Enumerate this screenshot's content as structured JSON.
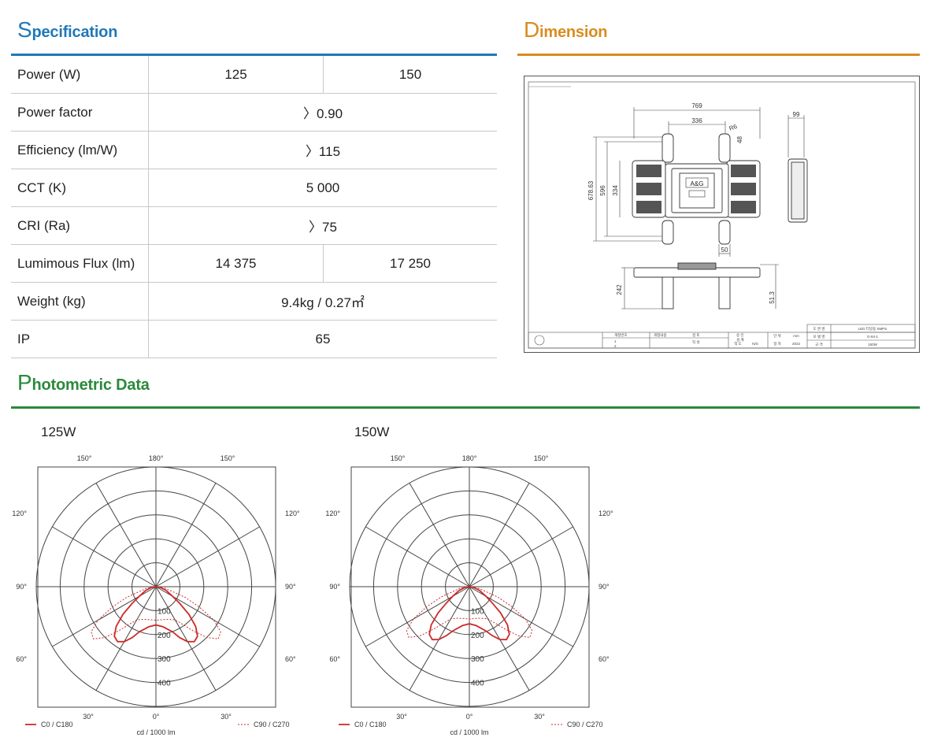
{
  "specification": {
    "title_cap": "S",
    "title_rest": "pecification",
    "rows": [
      {
        "label": "Power (W)",
        "values": [
          "125",
          "150"
        ]
      },
      {
        "label": "Power factor",
        "values": [
          "〉0.90"
        ]
      },
      {
        "label": "Efficiency (lm/W)",
        "values": [
          "〉115"
        ]
      },
      {
        "label": "CCT (K)",
        "values": [
          "5 000"
        ]
      },
      {
        "label": "CRI (Ra)",
        "values": [
          "〉75"
        ]
      },
      {
        "label": "Lumimous Flux (lm)",
        "values": [
          "14 375",
          "17 250"
        ]
      },
      {
        "label": "Weight (kg)",
        "values": [
          "9.4kg / 0.27㎡"
        ]
      },
      {
        "label": "IP",
        "values": [
          "65"
        ]
      }
    ]
  },
  "dimension": {
    "title_cap": "D",
    "title_rest": "imension",
    "drawing": {
      "dims": {
        "overall_width": "769",
        "center_width": "336",
        "radius": "R6",
        "hole": "48",
        "side_depth": "99",
        "height_total": "678.63",
        "height_mid": "596",
        "height_inner": "334",
        "foot": "50",
        "side_height": "242",
        "profile_height": "51.3"
      },
      "logo_text": "A&G",
      "title_block": {
        "name_label": "도 면 명",
        "name_value": "LED 터널용 SMPS",
        "code_label": "모 델 명",
        "code_value": "G-84-1",
        "spec_label": "규 격",
        "spec_value": "150W",
        "unit_label": "단 위",
        "unit_value": "mm",
        "scale_label": "척 도",
        "scale_value": "N/S",
        "date_label": "일 자",
        "date_value": "2022",
        "col_a": "개정번호",
        "col_b": "개정내용",
        "row1": "1",
        "row2": "2",
        "approve": "승 인",
        "check": "검 토",
        "draw": "작 성",
        "design": "설 계"
      }
    }
  },
  "photometric": {
    "title_cap": "P",
    "title_rest": "hotometric Data",
    "legend_c0": "C0 / C180",
    "legend_c90": "C90 / C270",
    "unit": "cd / 1000 lm",
    "color_c0": "#cc2a2a",
    "color_c90": "#cc2a2a",
    "charts": [
      {
        "name": "125W",
        "chart_data": {
          "type": "polar",
          "title": "125W",
          "angle_labels": [
            "180°",
            "150°",
            "150°",
            "120°",
            "120°",
            "90°",
            "90°",
            "60°",
            "60°",
            "30°",
            "30°",
            "0°"
          ],
          "radial_ticks": [
            100,
            200,
            300,
            400
          ],
          "rmax": 500,
          "series": [
            {
              "name": "C0 / C180",
              "style": "solid",
              "angles": [
                -90,
                -80,
                -70,
                -60,
                -55,
                -50,
                -45,
                -40,
                -35,
                -30,
                -25,
                -20,
                -10,
                0,
                10,
                20,
                25,
                30,
                35,
                40,
                45,
                50,
                55,
                60,
                70,
                80,
                90
              ],
              "values": [
                0,
                20,
                45,
                80,
                120,
                180,
                235,
                270,
                280,
                265,
                235,
                200,
                170,
                160,
                170,
                200,
                235,
                265,
                280,
                270,
                235,
                180,
                120,
                80,
                45,
                20,
                0
              ]
            },
            {
              "name": "C90 / C270",
              "style": "dotted",
              "angles": [
                -90,
                -80,
                -70,
                -65,
                -60,
                -55,
                -50,
                -45,
                -40,
                -35,
                -30,
                -20,
                -10,
                0,
                10,
                20,
                30,
                35,
                40,
                45,
                50,
                55,
                60,
                65,
                70,
                80,
                90
              ],
              "values": [
                0,
                40,
                130,
                200,
                280,
                330,
                340,
                300,
                240,
                190,
                160,
                145,
                140,
                140,
                140,
                145,
                160,
                190,
                240,
                300,
                340,
                330,
                280,
                200,
                130,
                40,
                0
              ]
            }
          ]
        }
      },
      {
        "name": "150W",
        "chart_data": {
          "type": "polar",
          "title": "150W",
          "angle_labels": [
            "180°",
            "150°",
            "150°",
            "120°",
            "120°",
            "90°",
            "90°",
            "60°",
            "60°",
            "30°",
            "30°",
            "0°"
          ],
          "radial_ticks": [
            100,
            200,
            300,
            400
          ],
          "rmax": 500,
          "series": [
            {
              "name": "C0 / C180",
              "style": "solid",
              "angles": [
                -90,
                -80,
                -70,
                -60,
                -55,
                -50,
                -45,
                -40,
                -35,
                -30,
                -25,
                -20,
                -10,
                0,
                10,
                20,
                25,
                30,
                35,
                40,
                45,
                50,
                55,
                60,
                70,
                80,
                90
              ],
              "values": [
                0,
                20,
                45,
                80,
                115,
                170,
                225,
                260,
                270,
                255,
                225,
                195,
                165,
                155,
                165,
                195,
                225,
                255,
                270,
                260,
                225,
                170,
                115,
                80,
                45,
                20,
                0
              ]
            },
            {
              "name": "C90 / C270",
              "style": "dotted",
              "angles": [
                -90,
                -80,
                -70,
                -65,
                -60,
                -55,
                -50,
                -45,
                -40,
                -35,
                -30,
                -20,
                -10,
                0,
                10,
                20,
                30,
                35,
                40,
                45,
                50,
                55,
                60,
                65,
                70,
                80,
                90
              ],
              "values": [
                0,
                40,
                125,
                195,
                270,
                320,
                330,
                290,
                230,
                185,
                155,
                140,
                135,
                135,
                135,
                140,
                155,
                185,
                230,
                290,
                330,
                320,
                270,
                195,
                125,
                40,
                0
              ]
            }
          ]
        }
      }
    ]
  }
}
